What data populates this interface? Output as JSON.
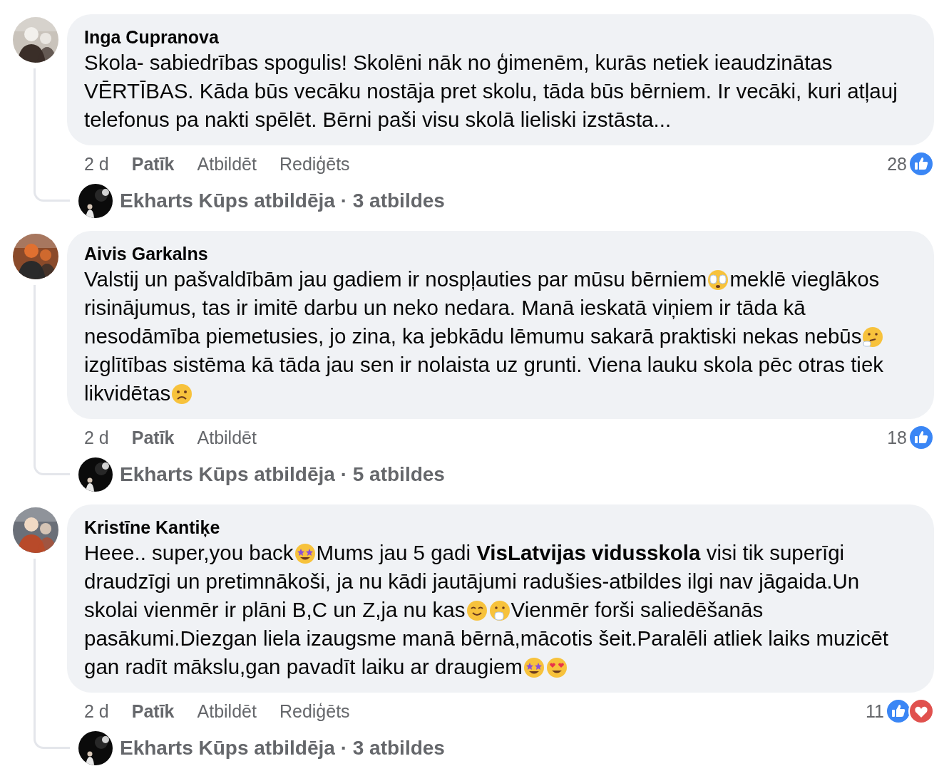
{
  "comments": [
    {
      "author": "Inga Cupranova",
      "avatar": {
        "kind": "picture"
      },
      "lines": [
        [
          {
            "kind": "text",
            "text": "Skola- sabiedrības spogulis! Skolēni nāk no ģimenēm, kurās netiek ieaudzinātas"
          }
        ],
        [
          {
            "kind": "text",
            "text": "VĒRTĪBAS. Kāda būs vecāku nostāja pret skolu, tāda būs bērniem. Ir vecāki, kuri atļauj"
          }
        ],
        [
          {
            "kind": "text",
            "text": "telefonus pa nakti spēlēt. Bērni paši visu skolā lieliski izstāsta..."
          }
        ]
      ],
      "time": "2 d",
      "like": "Patīk",
      "reply": "Atbildēt",
      "edited": "Rediģēts",
      "count": "28",
      "reactions": [
        {
          "kind": "like"
        }
      ],
      "replies": {
        "avatar": {
          "kind": "picture"
        },
        "text": "Ekharts Kūps atbildēja · 3 atbildes"
      }
    },
    {
      "author": "Aivis Garkalns",
      "avatar": {
        "kind": "picture"
      },
      "lines": [
        [
          {
            "kind": "text",
            "text": "Valstij un pašvaldībām jau gadiem ir nospļauties par mūsu bērniem"
          },
          {
            "kind": "covered-eyes"
          },
          {
            "kind": "text",
            "text": "meklē vieglākos"
          }
        ],
        [
          {
            "kind": "text",
            "text": "risinājumus, tas ir imitē darbu un neko nedara. Manā ieskatā viņiem ir tāda kā"
          }
        ],
        [
          {
            "kind": "text",
            "text": "nesodāmība piemetusies, jo zina, ka jebkādu lēmumu sakarā praktiski nekas nebūs"
          },
          {
            "kind": "thinking"
          }
        ],
        [
          {
            "kind": "text",
            "text": "izglītības sistēma kā tāda jau sen ir nolaista uz grunti. Viena lauku skola pēc otras tiek"
          }
        ],
        [
          {
            "kind": "text",
            "text": "likvidētas"
          },
          {
            "kind": "sad"
          }
        ]
      ],
      "time": "2 d",
      "like": "Patīk",
      "reply": "Atbildēt",
      "count": "18",
      "reactions": [
        {
          "kind": "like"
        }
      ],
      "replies": {
        "avatar": {
          "kind": "picture"
        },
        "text": "Ekharts Kūps atbildēja · 5 atbildes"
      }
    },
    {
      "author": "Kristīne Kantiķe",
      "avatar": {
        "kind": "picture"
      },
      "lines": [
        [
          {
            "kind": "text",
            "text": "Heee.. super,you back"
          },
          {
            "kind": "star-struck"
          },
          {
            "kind": "text",
            "text": "Mums jau 5 gadi **VisLatvijas vidusskola** visi tik superīgi"
          }
        ],
        [
          {
            "kind": "text",
            "text": "draudzīgi un pretimnākoši, ja nu kādi jautājumi radušies-atbildes ilgi nav jāgaida.Un"
          }
        ],
        [
          {
            "kind": "text",
            "text": "skolai vienmēr ir plāni B,C un Z,ja nu kas"
          },
          {
            "kind": "smile"
          },
          {
            "kind": "hand-over-mouth"
          },
          {
            "kind": "text",
            "text": "Vienmēr forši saliedēšanās"
          }
        ],
        [
          {
            "kind": "text",
            "text": "pasākumi.Diezgan liela izaugsme manā bērnā,mācotis šeit.Paralēli atliek laiks muzicēt"
          }
        ],
        [
          {
            "kind": "text",
            "text": "gan radīt mākslu,gan pavadīt laiku ar draugiem"
          },
          {
            "kind": "star-struck"
          },
          {
            "kind": "heart-eyes"
          }
        ]
      ],
      "time": "2 d",
      "like": "Patīk",
      "reply": "Atbildēt",
      "edited": "Rediģēts",
      "count": "11",
      "reactions": [
        {
          "kind": "like"
        },
        {
          "kind": "love"
        }
      ],
      "replies": {
        "avatar": {
          "kind": "picture"
        },
        "text": "Ekharts Kūps atbildēja · 3 atbildes"
      }
    }
  ]
}
